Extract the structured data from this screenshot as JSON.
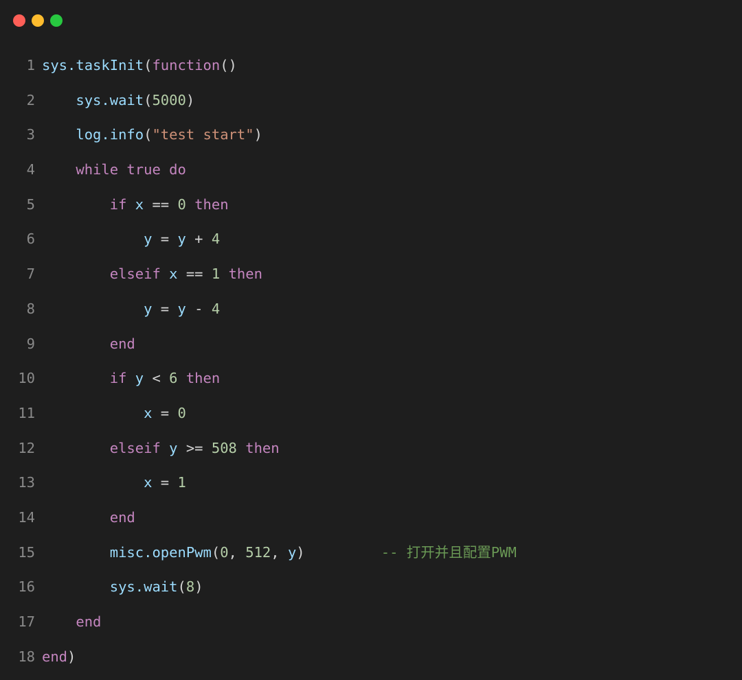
{
  "window": {
    "controls": [
      {
        "name": "close-button",
        "color": "#ff5f57"
      },
      {
        "name": "minimize-button",
        "color": "#febc2e"
      },
      {
        "name": "maximize-button",
        "color": "#28c840"
      }
    ]
  },
  "code": {
    "language": "lua",
    "lines": [
      {
        "num": "1",
        "tokens": [
          [
            "id",
            "sys.taskInit"
          ],
          [
            "punc",
            "("
          ],
          [
            "kw",
            "function"
          ],
          [
            "punc",
            "()"
          ]
        ]
      },
      {
        "num": "2",
        "tokens": [
          [
            "sp",
            "    "
          ],
          [
            "id",
            "sys.wait"
          ],
          [
            "punc",
            "("
          ],
          [
            "num",
            "5000"
          ],
          [
            "punc",
            ")"
          ]
        ]
      },
      {
        "num": "3",
        "tokens": [
          [
            "sp",
            "    "
          ],
          [
            "id",
            "log.info"
          ],
          [
            "punc",
            "("
          ],
          [
            "str",
            "\"test start\""
          ],
          [
            "punc",
            ")"
          ]
        ]
      },
      {
        "num": "4",
        "tokens": [
          [
            "sp",
            "    "
          ],
          [
            "kw",
            "while true do"
          ]
        ]
      },
      {
        "num": "5",
        "tokens": [
          [
            "sp",
            "        "
          ],
          [
            "kw",
            "if"
          ],
          [
            "sp",
            " "
          ],
          [
            "id",
            "x"
          ],
          [
            "op",
            " == "
          ],
          [
            "num",
            "0"
          ],
          [
            "sp",
            " "
          ],
          [
            "kw",
            "then"
          ]
        ]
      },
      {
        "num": "6",
        "tokens": [
          [
            "sp",
            "            "
          ],
          [
            "id",
            "y"
          ],
          [
            "op",
            " = "
          ],
          [
            "id",
            "y"
          ],
          [
            "op",
            " + "
          ],
          [
            "num",
            "4"
          ]
        ]
      },
      {
        "num": "7",
        "tokens": [
          [
            "sp",
            "        "
          ],
          [
            "kw",
            "elseif"
          ],
          [
            "sp",
            " "
          ],
          [
            "id",
            "x"
          ],
          [
            "op",
            " == "
          ],
          [
            "num",
            "1"
          ],
          [
            "sp",
            " "
          ],
          [
            "kw",
            "then"
          ]
        ]
      },
      {
        "num": "8",
        "tokens": [
          [
            "sp",
            "            "
          ],
          [
            "id",
            "y"
          ],
          [
            "op",
            " = "
          ],
          [
            "id",
            "y"
          ],
          [
            "op",
            " - "
          ],
          [
            "num",
            "4"
          ]
        ]
      },
      {
        "num": "9",
        "tokens": [
          [
            "sp",
            "        "
          ],
          [
            "kw",
            "end"
          ]
        ]
      },
      {
        "num": "10",
        "tokens": [
          [
            "sp",
            "        "
          ],
          [
            "kw",
            "if"
          ],
          [
            "sp",
            " "
          ],
          [
            "id",
            "y"
          ],
          [
            "op",
            " < "
          ],
          [
            "num",
            "6"
          ],
          [
            "sp",
            " "
          ],
          [
            "kw",
            "then"
          ]
        ]
      },
      {
        "num": "11",
        "tokens": [
          [
            "sp",
            "            "
          ],
          [
            "id",
            "x"
          ],
          [
            "op",
            " = "
          ],
          [
            "num",
            "0"
          ]
        ]
      },
      {
        "num": "12",
        "tokens": [
          [
            "sp",
            "        "
          ],
          [
            "kw",
            "elseif"
          ],
          [
            "sp",
            " "
          ],
          [
            "id",
            "y"
          ],
          [
            "op",
            " >= "
          ],
          [
            "num",
            "508"
          ],
          [
            "sp",
            " "
          ],
          [
            "kw",
            "then"
          ]
        ]
      },
      {
        "num": "13",
        "tokens": [
          [
            "sp",
            "            "
          ],
          [
            "id",
            "x"
          ],
          [
            "op",
            " = "
          ],
          [
            "num",
            "1"
          ]
        ]
      },
      {
        "num": "14",
        "tokens": [
          [
            "sp",
            "        "
          ],
          [
            "kw",
            "end"
          ]
        ]
      },
      {
        "num": "15",
        "tokens": [
          [
            "sp",
            "        "
          ],
          [
            "id",
            "misc.openPwm"
          ],
          [
            "punc",
            "("
          ],
          [
            "num",
            "0"
          ],
          [
            "punc",
            ", "
          ],
          [
            "num",
            "512"
          ],
          [
            "punc",
            ", "
          ],
          [
            "id",
            "y"
          ],
          [
            "punc",
            ")"
          ],
          [
            "sp",
            "         "
          ],
          [
            "com",
            "-- 打开并且配置PWM"
          ]
        ]
      },
      {
        "num": "16",
        "tokens": [
          [
            "sp",
            "        "
          ],
          [
            "id",
            "sys.wait"
          ],
          [
            "punc",
            "("
          ],
          [
            "num",
            "8"
          ],
          [
            "punc",
            ")"
          ]
        ]
      },
      {
        "num": "17",
        "tokens": [
          [
            "sp",
            "    "
          ],
          [
            "kw",
            "end"
          ]
        ]
      },
      {
        "num": "18",
        "tokens": [
          [
            "kw",
            "end"
          ],
          [
            "punc",
            ")"
          ]
        ]
      }
    ]
  },
  "colors": {
    "background": "#1e1e1e",
    "identifier": "#9cdcfe",
    "keyword": "#c586c0",
    "number": "#b5cea8",
    "string": "#ce9178",
    "comment": "#6a9955",
    "line_number": "#8a8a8a"
  }
}
